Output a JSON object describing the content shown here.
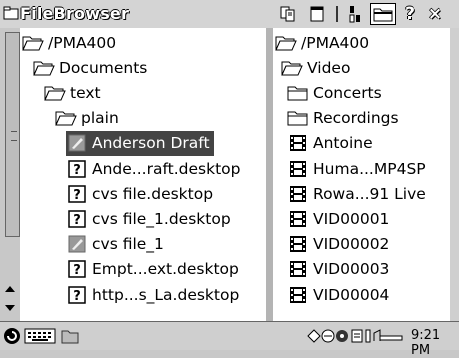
{
  "title": "FileBrowser",
  "left_pane": {
    "items": [
      {
        "label": "/PMA400",
        "icon": "folder-open-icon",
        "indent": 0,
        "selected": false
      },
      {
        "label": "Documents",
        "icon": "folder-open-icon",
        "indent": 1,
        "selected": false
      },
      {
        "label": "text",
        "icon": "folder-open-icon",
        "indent": 2,
        "selected": false
      },
      {
        "label": "plain",
        "icon": "folder-open-icon",
        "indent": 3,
        "selected": false
      },
      {
        "label": "Anderson Draft",
        "icon": "document-edit-icon",
        "indent": 4,
        "selected": true
      },
      {
        "label": "Ande...raft.desktop",
        "icon": "unknown-file-icon",
        "indent": 4,
        "selected": false
      },
      {
        "label": "cvs file.desktop",
        "icon": "unknown-file-icon",
        "indent": 4,
        "selected": false
      },
      {
        "label": "cvs file_1.desktop",
        "icon": "unknown-file-icon",
        "indent": 4,
        "selected": false
      },
      {
        "label": "cvs file_1",
        "icon": "document-edit-icon",
        "indent": 4,
        "selected": false
      },
      {
        "label": "Empt...ext.desktop",
        "icon": "unknown-file-icon",
        "indent": 4,
        "selected": false
      },
      {
        "label": "http...s_La.desktop",
        "icon": "unknown-file-icon",
        "indent": 4,
        "selected": false
      }
    ]
  },
  "right_pane": {
    "items": [
      {
        "label": "/PMA400",
        "icon": "folder-open-icon",
        "indent": 0
      },
      {
        "label": "Video",
        "icon": "folder-open-icon",
        "indent": 1
      },
      {
        "label": "Concerts",
        "icon": "folder-closed-icon",
        "indent": 2
      },
      {
        "label": "Recordings",
        "icon": "folder-closed-icon",
        "indent": 2
      },
      {
        "label": "Antoine",
        "icon": "film-icon",
        "indent": 2
      },
      {
        "label": "Huma...MP4SP",
        "icon": "film-icon",
        "indent": 2
      },
      {
        "label": "Rowa...91 Live",
        "icon": "film-icon",
        "indent": 2
      },
      {
        "label": "VID00001",
        "icon": "film-icon",
        "indent": 2
      },
      {
        "label": "VID00002",
        "icon": "film-icon",
        "indent": 2
      },
      {
        "label": "VID00003",
        "icon": "film-icon",
        "indent": 2
      },
      {
        "label": "VID00004",
        "icon": "film-icon",
        "indent": 2
      }
    ]
  },
  "status": {
    "time": "9:21 PM"
  },
  "toolbar": {
    "help": "?",
    "close": "×"
  }
}
